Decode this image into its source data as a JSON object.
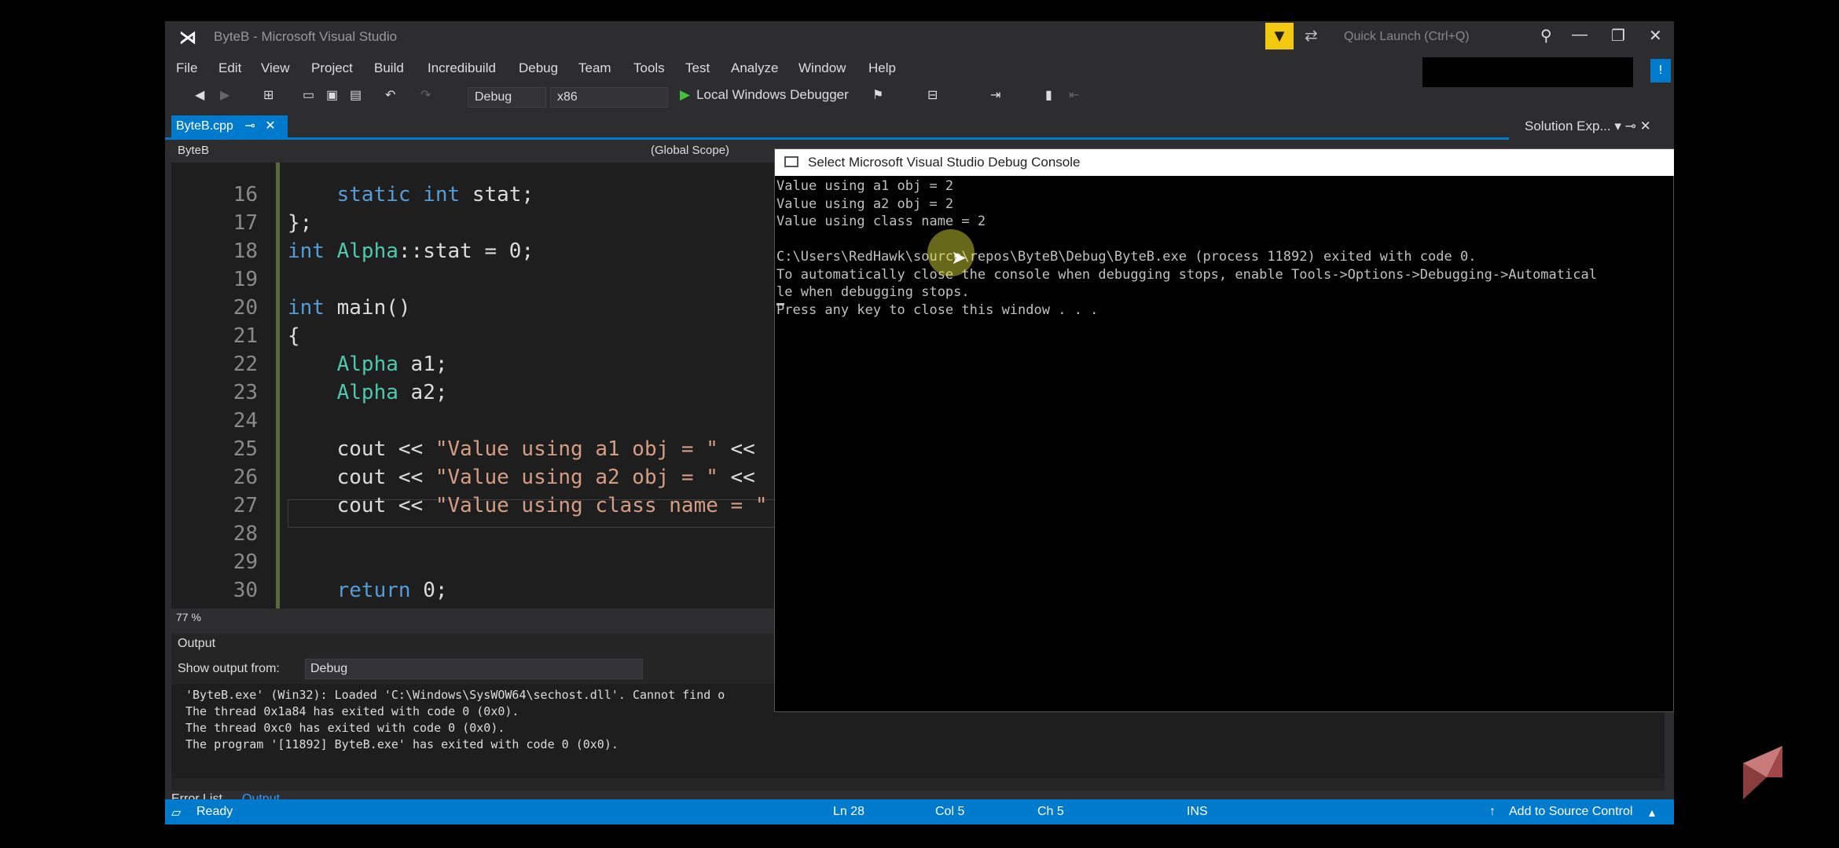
{
  "window": {
    "title": "ByteB - Microsoft Visual Studio",
    "quick_launch": "Quick Launch (Ctrl+Q)"
  },
  "menu": [
    "File",
    "Edit",
    "View",
    "Project",
    "Build",
    "Incredibuild",
    "Debug",
    "Team",
    "Tools",
    "Test",
    "Analyze",
    "Window",
    "Help"
  ],
  "toolbar": {
    "config": "Debug",
    "platform": "x86",
    "run_label": "Local Windows Debugger"
  },
  "tabs": {
    "active": "ByteB.cpp",
    "solution_explorer": "Solution Exp..."
  },
  "nav": {
    "project": "ByteB",
    "scope": "(Global Scope)"
  },
  "editor": {
    "line_numbers": [
      "16",
      "17",
      "18",
      "19",
      "20",
      "21",
      "22",
      "23",
      "24",
      "25",
      "26",
      "27",
      "28",
      "29",
      "30"
    ],
    "zoom": "77 %"
  },
  "console": {
    "title": "Select Microsoft Visual Studio Debug Console",
    "lines": [
      "Value using a1 obj = 2",
      "Value using a2 obj = 2",
      "Value using class name = 2",
      "",
      "C:\\Users\\RedHawk\\source\\repos\\ByteB\\Debug\\ByteB.exe (process 11892) exited with code 0.",
      "To automatically close the console when debugging stops, enable Tools->Options->Debugging->Automatical",
      "le when debugging stops.",
      "Press any key to close this window . . ."
    ]
  },
  "output": {
    "title": "Output",
    "show_from_label": "Show output from:",
    "show_from_value": "Debug",
    "lines": [
      "'ByteB.exe' (Win32): Loaded 'C:\\Windows\\SysWOW64\\sechost.dll'. Cannot find o",
      "The thread 0x1a84 has exited with code 0 (0x0).",
      "The thread 0xc0 has exited with code 0 (0x0).",
      "The program '[11892] ByteB.exe' has exited with code 0 (0x0)."
    ]
  },
  "bottom_tabs": {
    "error_list": "Error List",
    "output": "Output"
  },
  "status": {
    "ready": "Ready",
    "ln": "Ln 28",
    "col": "Col 5",
    "ch": "Ch 5",
    "mode": "INS",
    "source_control": "Add to Source Control"
  },
  "colors": {
    "accent": "#007acc",
    "filter": "#f2c811"
  }
}
